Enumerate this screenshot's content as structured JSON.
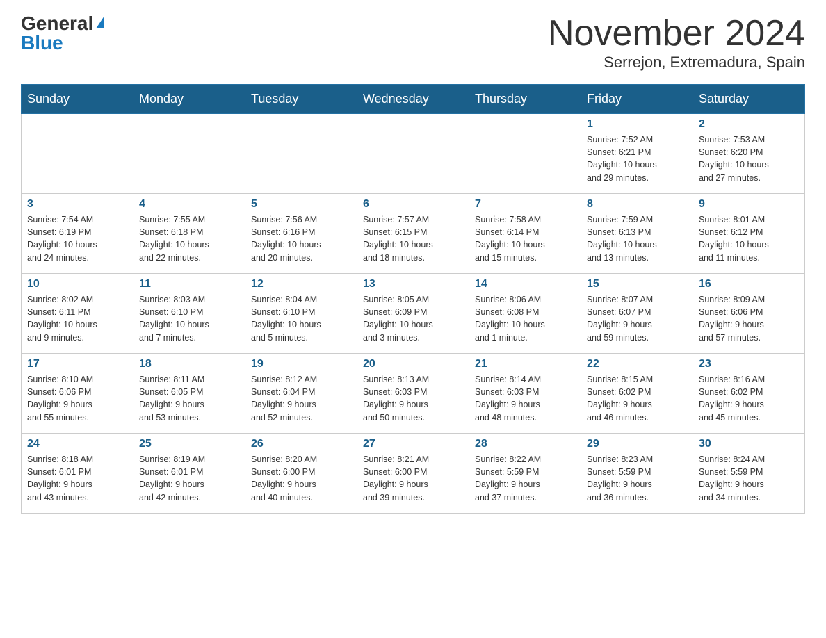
{
  "logo": {
    "general": "General",
    "blue": "Blue"
  },
  "title": {
    "month_year": "November 2024",
    "location": "Serrejon, Extremadura, Spain"
  },
  "weekdays": [
    "Sunday",
    "Monday",
    "Tuesday",
    "Wednesday",
    "Thursday",
    "Friday",
    "Saturday"
  ],
  "weeks": [
    [
      {
        "day": "",
        "info": ""
      },
      {
        "day": "",
        "info": ""
      },
      {
        "day": "",
        "info": ""
      },
      {
        "day": "",
        "info": ""
      },
      {
        "day": "",
        "info": ""
      },
      {
        "day": "1",
        "info": "Sunrise: 7:52 AM\nSunset: 6:21 PM\nDaylight: 10 hours\nand 29 minutes."
      },
      {
        "day": "2",
        "info": "Sunrise: 7:53 AM\nSunset: 6:20 PM\nDaylight: 10 hours\nand 27 minutes."
      }
    ],
    [
      {
        "day": "3",
        "info": "Sunrise: 7:54 AM\nSunset: 6:19 PM\nDaylight: 10 hours\nand 24 minutes."
      },
      {
        "day": "4",
        "info": "Sunrise: 7:55 AM\nSunset: 6:18 PM\nDaylight: 10 hours\nand 22 minutes."
      },
      {
        "day": "5",
        "info": "Sunrise: 7:56 AM\nSunset: 6:16 PM\nDaylight: 10 hours\nand 20 minutes."
      },
      {
        "day": "6",
        "info": "Sunrise: 7:57 AM\nSunset: 6:15 PM\nDaylight: 10 hours\nand 18 minutes."
      },
      {
        "day": "7",
        "info": "Sunrise: 7:58 AM\nSunset: 6:14 PM\nDaylight: 10 hours\nand 15 minutes."
      },
      {
        "day": "8",
        "info": "Sunrise: 7:59 AM\nSunset: 6:13 PM\nDaylight: 10 hours\nand 13 minutes."
      },
      {
        "day": "9",
        "info": "Sunrise: 8:01 AM\nSunset: 6:12 PM\nDaylight: 10 hours\nand 11 minutes."
      }
    ],
    [
      {
        "day": "10",
        "info": "Sunrise: 8:02 AM\nSunset: 6:11 PM\nDaylight: 10 hours\nand 9 minutes."
      },
      {
        "day": "11",
        "info": "Sunrise: 8:03 AM\nSunset: 6:10 PM\nDaylight: 10 hours\nand 7 minutes."
      },
      {
        "day": "12",
        "info": "Sunrise: 8:04 AM\nSunset: 6:10 PM\nDaylight: 10 hours\nand 5 minutes."
      },
      {
        "day": "13",
        "info": "Sunrise: 8:05 AM\nSunset: 6:09 PM\nDaylight: 10 hours\nand 3 minutes."
      },
      {
        "day": "14",
        "info": "Sunrise: 8:06 AM\nSunset: 6:08 PM\nDaylight: 10 hours\nand 1 minute."
      },
      {
        "day": "15",
        "info": "Sunrise: 8:07 AM\nSunset: 6:07 PM\nDaylight: 9 hours\nand 59 minutes."
      },
      {
        "day": "16",
        "info": "Sunrise: 8:09 AM\nSunset: 6:06 PM\nDaylight: 9 hours\nand 57 minutes."
      }
    ],
    [
      {
        "day": "17",
        "info": "Sunrise: 8:10 AM\nSunset: 6:06 PM\nDaylight: 9 hours\nand 55 minutes."
      },
      {
        "day": "18",
        "info": "Sunrise: 8:11 AM\nSunset: 6:05 PM\nDaylight: 9 hours\nand 53 minutes."
      },
      {
        "day": "19",
        "info": "Sunrise: 8:12 AM\nSunset: 6:04 PM\nDaylight: 9 hours\nand 52 minutes."
      },
      {
        "day": "20",
        "info": "Sunrise: 8:13 AM\nSunset: 6:03 PM\nDaylight: 9 hours\nand 50 minutes."
      },
      {
        "day": "21",
        "info": "Sunrise: 8:14 AM\nSunset: 6:03 PM\nDaylight: 9 hours\nand 48 minutes."
      },
      {
        "day": "22",
        "info": "Sunrise: 8:15 AM\nSunset: 6:02 PM\nDaylight: 9 hours\nand 46 minutes."
      },
      {
        "day": "23",
        "info": "Sunrise: 8:16 AM\nSunset: 6:02 PM\nDaylight: 9 hours\nand 45 minutes."
      }
    ],
    [
      {
        "day": "24",
        "info": "Sunrise: 8:18 AM\nSunset: 6:01 PM\nDaylight: 9 hours\nand 43 minutes."
      },
      {
        "day": "25",
        "info": "Sunrise: 8:19 AM\nSunset: 6:01 PM\nDaylight: 9 hours\nand 42 minutes."
      },
      {
        "day": "26",
        "info": "Sunrise: 8:20 AM\nSunset: 6:00 PM\nDaylight: 9 hours\nand 40 minutes."
      },
      {
        "day": "27",
        "info": "Sunrise: 8:21 AM\nSunset: 6:00 PM\nDaylight: 9 hours\nand 39 minutes."
      },
      {
        "day": "28",
        "info": "Sunrise: 8:22 AM\nSunset: 5:59 PM\nDaylight: 9 hours\nand 37 minutes."
      },
      {
        "day": "29",
        "info": "Sunrise: 8:23 AM\nSunset: 5:59 PM\nDaylight: 9 hours\nand 36 minutes."
      },
      {
        "day": "30",
        "info": "Sunrise: 8:24 AM\nSunset: 5:59 PM\nDaylight: 9 hours\nand 34 minutes."
      }
    ]
  ]
}
